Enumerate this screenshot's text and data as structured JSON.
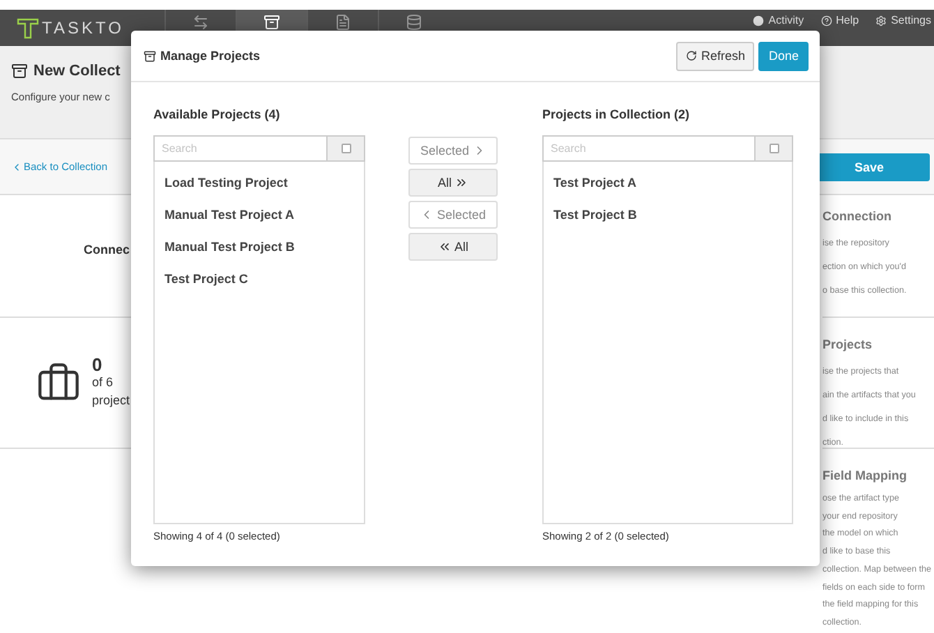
{
  "navbar": {
    "logo": "TASKTO",
    "nav_items": [
      {
        "selected": false
      },
      {
        "selected": true
      },
      {
        "selected": false
      },
      {
        "selected": false
      }
    ],
    "links": [
      {
        "label": "Activity"
      },
      {
        "label": "Help"
      },
      {
        "label": "Settings"
      }
    ]
  },
  "page": {
    "title": "New Collect",
    "subtitle": "Configure your new c",
    "back_link": "Back to Collection",
    "save_button": "Save",
    "connection_label": "Connec",
    "projects_stat": {
      "count": "0",
      "total": "of 6",
      "unit": "project"
    }
  },
  "help": [
    {
      "title": "Connection",
      "lines": [
        "ise the repository",
        "ection on which you'd",
        "o base this collection."
      ]
    },
    {
      "title": "Projects",
      "lines": [
        "ise the projects that",
        "ain the artifacts that you",
        "d like to include in this",
        "ction."
      ]
    },
    {
      "title": "Field Mapping",
      "lines": [
        "ose the artifact type",
        "your end repository",
        "the model on which",
        "d like to base this",
        "collection. Map between the",
        "fields on each side to form",
        "the field mapping for this",
        "collection."
      ]
    }
  ],
  "modal": {
    "title": "Manage Projects",
    "refresh_button": "Refresh",
    "done_button": "Done",
    "available": {
      "heading": "Available Projects (4)",
      "placeholder": "Search",
      "select_all_checked": false,
      "items": [
        {
          "label": "Load Testing Project",
          "selected": false
        },
        {
          "label": "Manual Test Project A",
          "selected": false
        },
        {
          "label": "Manual Test Project B",
          "selected": false
        },
        {
          "label": "Test Project C",
          "selected": false
        }
      ],
      "footer": "Showing 4 of 4 (0 selected)"
    },
    "transfer_buttons": [
      {
        "label": "Selected",
        "kind": "add-selected",
        "disabled": true
      },
      {
        "label": "All",
        "kind": "add-all",
        "disabled": false
      },
      {
        "label": "Selected",
        "kind": "remove-selected",
        "disabled": true
      },
      {
        "label": "All",
        "kind": "remove-all",
        "disabled": false
      }
    ],
    "collection": {
      "heading": "Projects in Collection (2)",
      "placeholder": "Search",
      "select_all_checked": false,
      "items": [
        {
          "label": "Test Project A",
          "selected": false
        },
        {
          "label": "Test Project B",
          "selected": false
        }
      ],
      "footer": "Showing 2 of 2 (0 selected)"
    }
  }
}
